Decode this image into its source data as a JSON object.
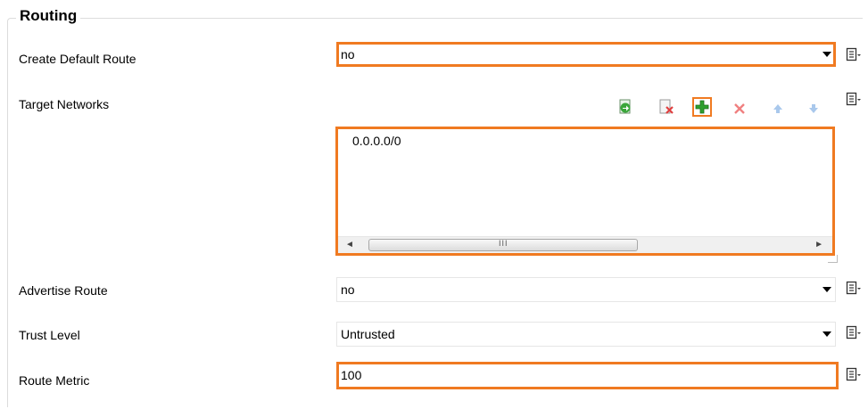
{
  "section": {
    "title": "Routing"
  },
  "fields": {
    "create_default_route": {
      "label": "Create Default Route",
      "value": "no"
    },
    "target_networks": {
      "label": "Target Networks",
      "items": [
        "0.0.0.0/0"
      ]
    },
    "advertise_route": {
      "label": "Advertise Route",
      "value": "no"
    },
    "trust_level": {
      "label": "Trust Level",
      "value": "Untrusted"
    },
    "route_metric": {
      "label": "Route Metric",
      "value": "100"
    }
  },
  "scrollbar": {
    "grip": "III",
    "left_arrow": "◄",
    "right_arrow": "►"
  },
  "colors": {
    "highlight": "#f07a21",
    "add_green": "#2ea02e",
    "delete_red": "#e04040",
    "move_blue": "#6a9ad8"
  },
  "icons": [
    "import-icon",
    "clear-list-icon",
    "add-icon",
    "delete-icon",
    "move-up-icon",
    "move-down-icon",
    "document-menu-icon"
  ]
}
